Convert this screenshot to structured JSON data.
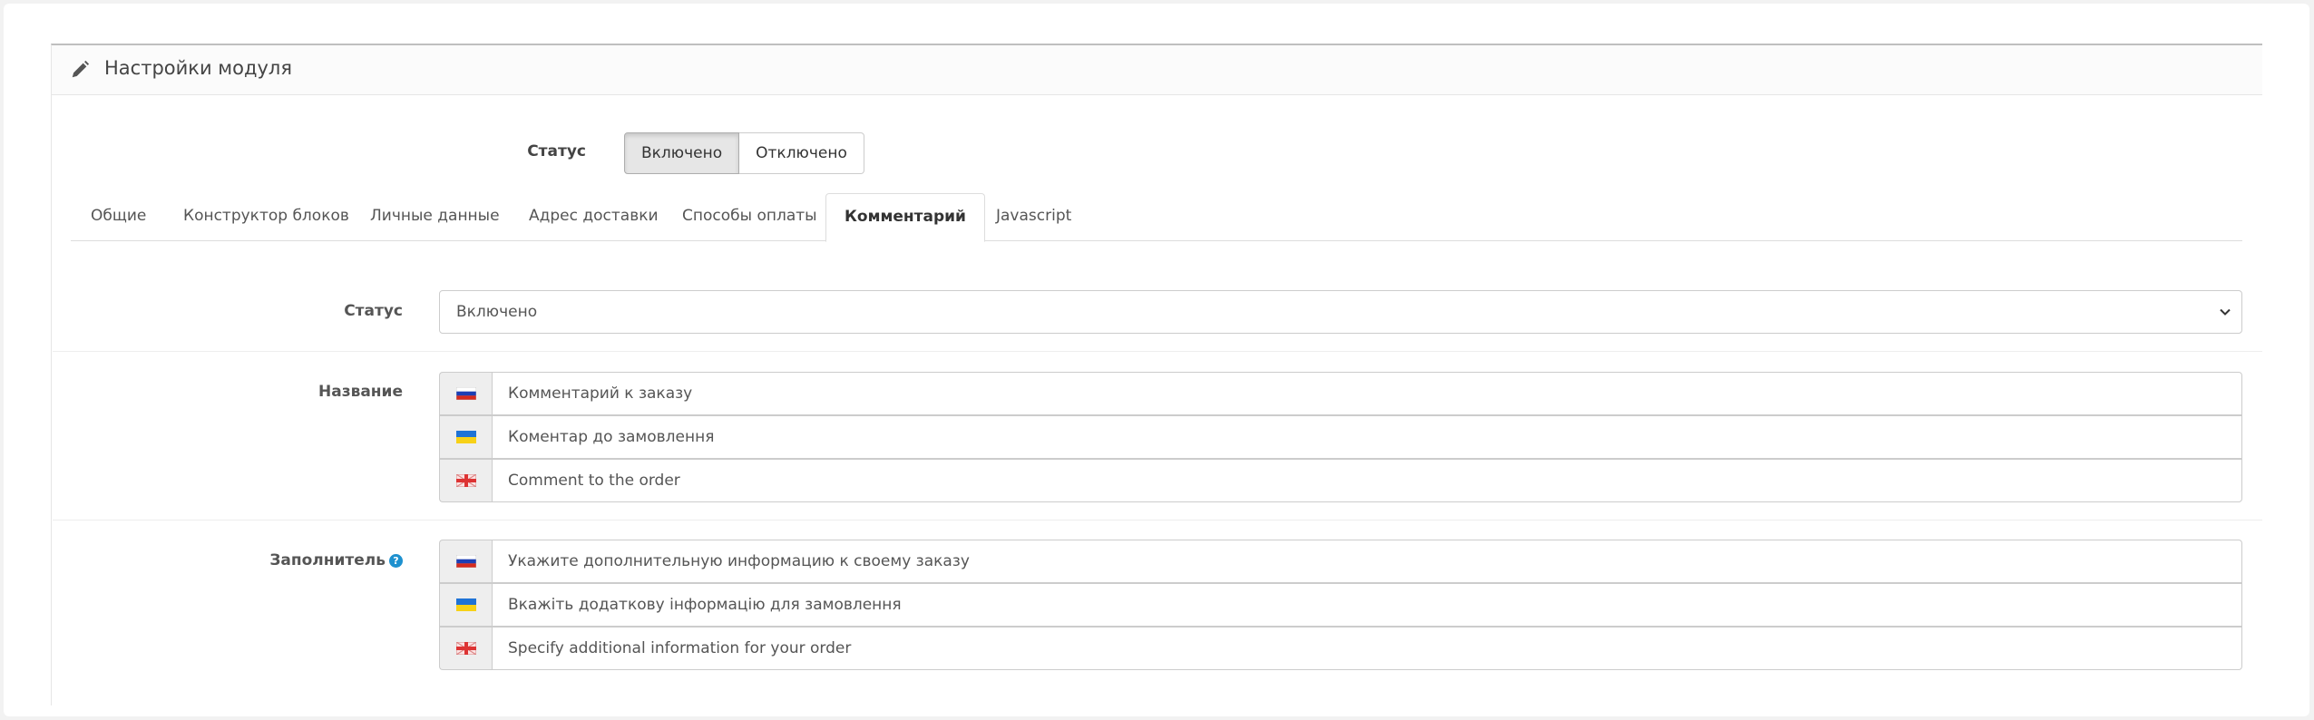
{
  "panel": {
    "title": "Настройки модуля"
  },
  "module_status": {
    "label": "Статус",
    "on_label": "Включено",
    "off_label": "Отключено",
    "selected": "Включено"
  },
  "tabs": [
    {
      "label": "Общие"
    },
    {
      "label": "Конструктор блоков"
    },
    {
      "label": "Личные данные"
    },
    {
      "label": "Адрес доставки"
    },
    {
      "label": "Способы оплаты"
    },
    {
      "label": "Комментарий",
      "active": true
    },
    {
      "label": "Javascript"
    }
  ],
  "comment_tab": {
    "status": {
      "label": "Статус",
      "value": "Включено"
    },
    "name": {
      "label": "Название",
      "values": [
        {
          "flag": "ru",
          "value": "Комментарий к заказу"
        },
        {
          "flag": "ua",
          "value": "Коментар до замовлення"
        },
        {
          "flag": "en",
          "value": "Comment to the order"
        }
      ]
    },
    "placeholder": {
      "label": "Заполнитель",
      "help_icon": "?",
      "values": [
        {
          "flag": "ru",
          "value": "Укажите дополнительную информацию к своему заказу"
        },
        {
          "flag": "ua",
          "value": "Вкажіть додаткову інформацію для замовлення"
        },
        {
          "flag": "en",
          "value": "Specify additional information for your order"
        }
      ]
    }
  },
  "colors": {
    "accent_blue": "#1e91cf",
    "border": "#cccccc",
    "addon_bg": "#eeeeee"
  }
}
